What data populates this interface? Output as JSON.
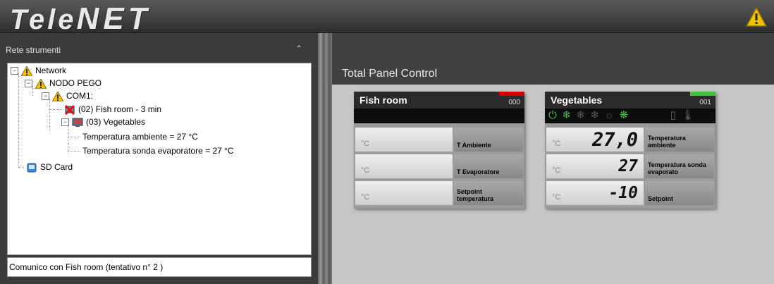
{
  "app": {
    "logo_left": "Tele",
    "logo_right": "NET"
  },
  "left_panel": {
    "title": "Rete strumenti",
    "collapse_icon": "double-chevron-up-icon",
    "tree": {
      "network": "Network",
      "nodo": "NODO PEGO",
      "com": "COM1:",
      "fish": "(02) Fish room - 3  min",
      "vegetables": "(03) Vegetables",
      "temp_amb": "Temperatura ambiente = 27 °C",
      "temp_sonda": "Temperatura sonda evaporatore = 27 °C",
      "sd": "SD Card"
    },
    "status": "Comunico con Fish room (tentativo n° 2 )"
  },
  "main": {
    "title": "Total Panel Control",
    "cards": [
      {
        "name": "Fish room",
        "number": "000",
        "status_color": "#d40000",
        "rows": [
          {
            "unit": "°C",
            "value": "",
            "label": "T Ambiente"
          },
          {
            "unit": "°C",
            "value": "",
            "label": "T Evaporatore"
          },
          {
            "unit": "°C",
            "value": "",
            "label": "Setpoint temperatura"
          }
        ]
      },
      {
        "name": "Vegetables",
        "number": "001",
        "status_color": "#3cc23c",
        "icons": [
          "power-icon",
          "snowflake-icon",
          "snowflake-icon",
          "snowflake-icon",
          "sun-icon",
          "fan-icon",
          "door-icon",
          "thermometer-icon"
        ],
        "rows": [
          {
            "unit": "°C",
            "value": "27,0",
            "label": "Temperatura ambiente"
          },
          {
            "unit": "°C",
            "value": "27",
            "label": "Temperatura sonda evaporato"
          },
          {
            "unit": "°C",
            "value": "-10",
            "label": "Setpoint"
          }
        ]
      }
    ]
  },
  "colors": {
    "warning": "#f2c200",
    "alarm": "#d40000",
    "ok": "#3cc23c"
  }
}
